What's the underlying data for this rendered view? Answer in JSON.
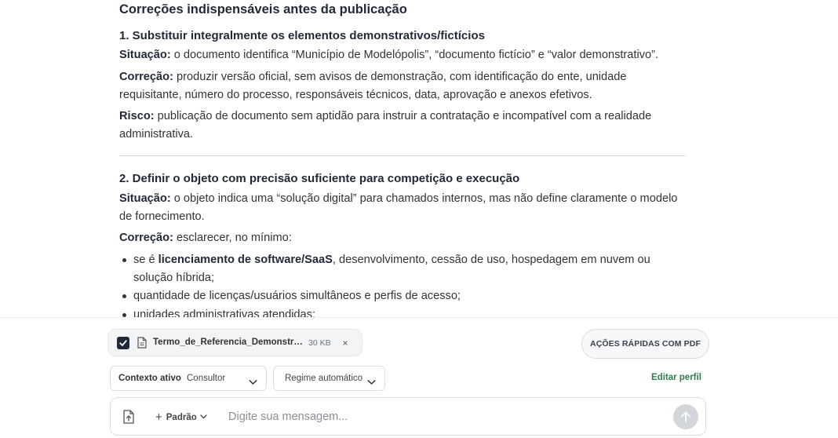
{
  "document": {
    "heading": "Correções indispensáveis antes da publicação",
    "section1": {
      "title": "1. Substituir integralmente os elementos demonstrativos/fictícios",
      "situacao_label": "Situação:",
      "situacao_text": " o documento identifica “Município de Modelópolis”, “documento fictício” e “valor demonstrativo”.",
      "correcao_label": "Correção:",
      "correcao_text": " produzir versão oficial, sem avisos de demonstração, com identificação do ente, unidade requisitante, número do processo, responsáveis técnicos, data, aprovação e anexos efetivos.",
      "risco_label": "Risco:",
      "risco_text": " publicação de documento sem aptidão para instruir a contratação e incompatível com a realidade administrativa."
    },
    "section2": {
      "title": "2. Definir o objeto com precisão suficiente para competição e execução",
      "situacao_label": "Situação:",
      "situacao_text": " o objeto indica uma “solução digital” para chamados internos, mas não define claramente o modelo de fornecimento.",
      "correcao_label": "Correção:",
      "correcao_text": " esclarecer, no mínimo:",
      "bullets": [
        {
          "prefix": "se é ",
          "bold": "licenciamento de software/SaaS",
          "suffix": ", desenvolvimento, cessão de uso, hospedagem em nuvem ou solução híbrida;"
        },
        {
          "prefix": "quantidade de licenças/usuários simultâneos e perfis de acesso;",
          "bold": "",
          "suffix": ""
        },
        {
          "prefix": "unidades administrativas atendidas;",
          "bold": "",
          "suffix": ""
        }
      ]
    }
  },
  "attachment": {
    "file_name": "Termo_de_Referencia_Demonstra...",
    "file_size": "30 KB",
    "checked": true,
    "close_symbol": "×"
  },
  "actions": {
    "quick_pdf_label": "AÇÕES RÁPIDAS COM PDF",
    "edit_profile_label": "Editar perfil"
  },
  "context": {
    "label": "Contexto ativo",
    "value": "Consultor"
  },
  "regime": {
    "value": "Regime automático"
  },
  "composer": {
    "mode_label": "Padrão",
    "mode_plus": "+",
    "placeholder": "Digite sua mensagem..."
  },
  "icons": {
    "checkbox": "checkbox-checked-icon",
    "file": "file-icon",
    "close": "close-icon",
    "chevron": "chevron-down-icon",
    "attach": "file-upload-icon",
    "send": "arrow-up-icon"
  },
  "colors": {
    "accent_green": "#2e7d4f",
    "send_disabled": "#d2d5d9",
    "divider": "#c9d4de"
  }
}
